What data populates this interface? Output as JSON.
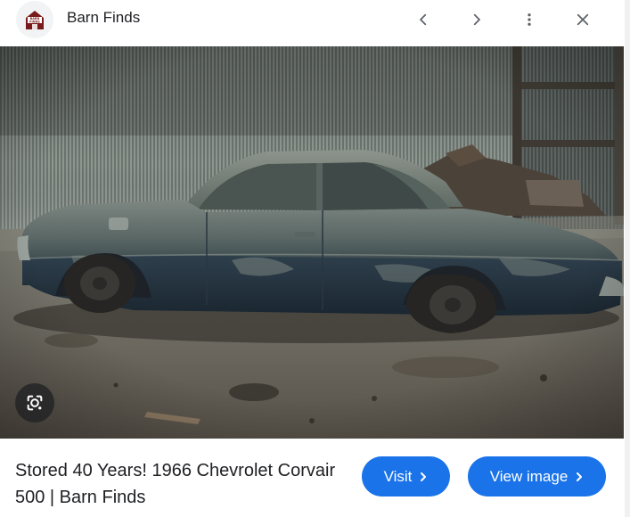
{
  "header": {
    "source_name": "Barn Finds",
    "favicon_label": "BARN FINDS",
    "prev_icon": "chevron-left-icon",
    "next_icon": "chevron-right-icon",
    "more_icon": "more-vert-icon",
    "close_icon": "close-icon"
  },
  "main_image": {
    "subject": "barn-find-car-photo",
    "lens_icon": "google-lens-icon"
  },
  "result": {
    "title": "Stored 40 Years! 1966 Chevrolet Corvair 500 | Barn Finds",
    "visit_label": "Visit",
    "view_image_label": "View image"
  },
  "colors": {
    "accent": "#1a73e8",
    "text": "#202124"
  }
}
